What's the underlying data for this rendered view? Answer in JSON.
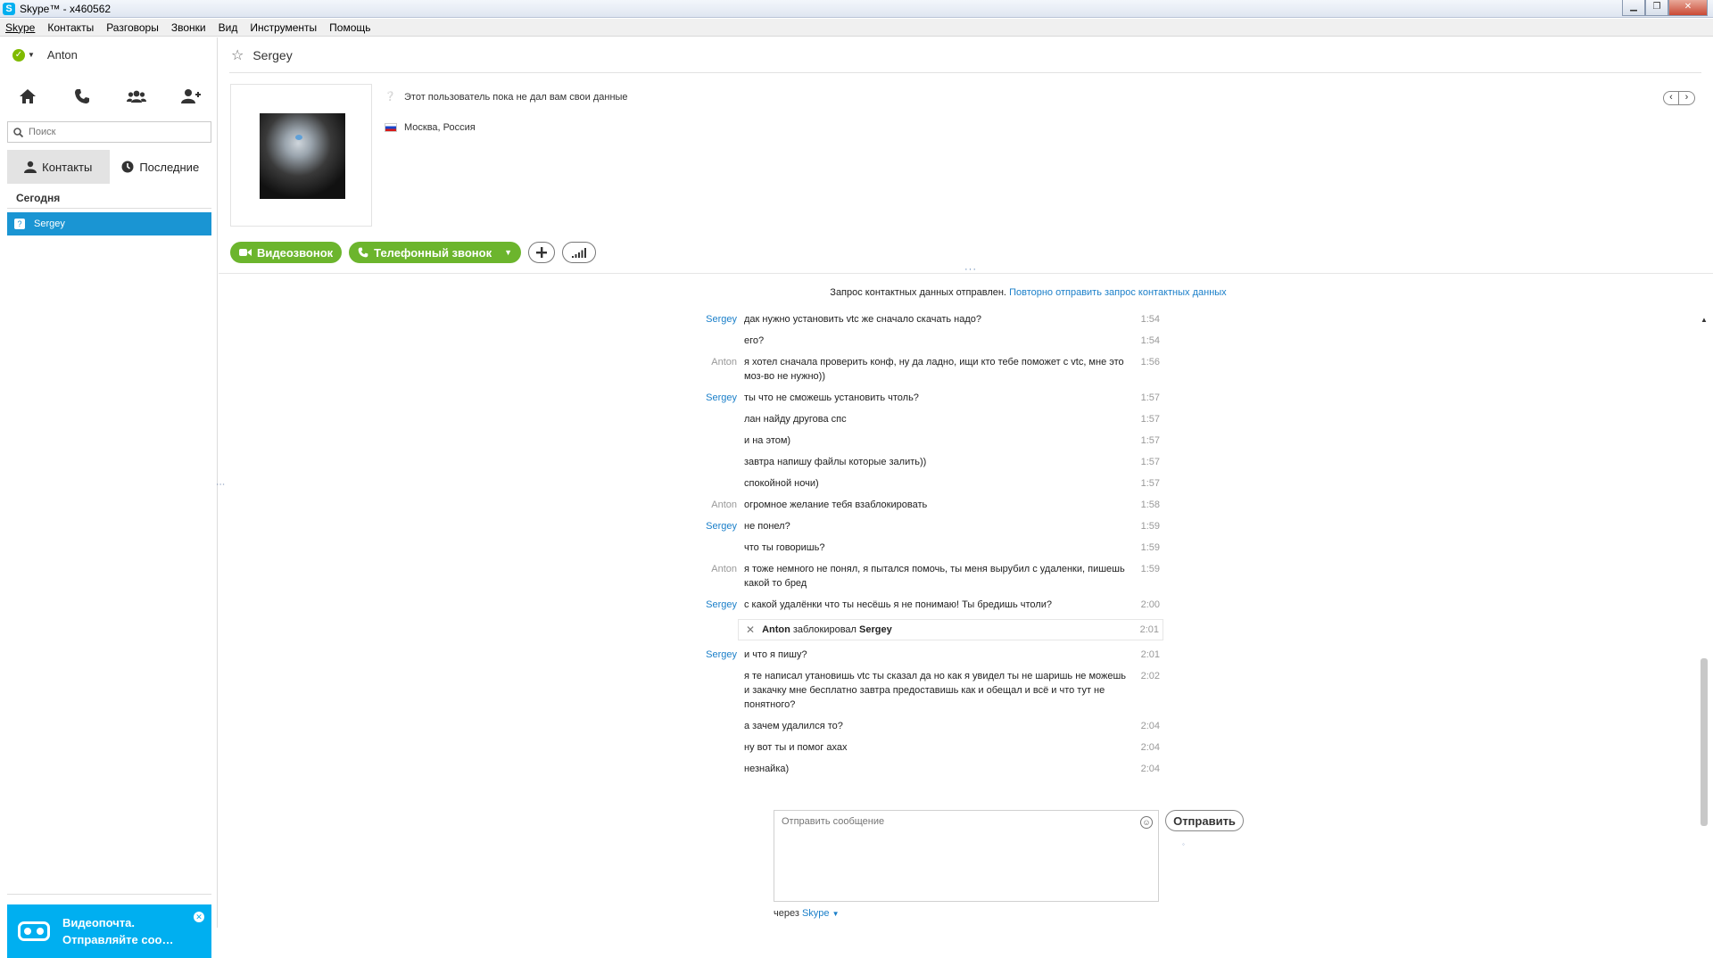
{
  "window": {
    "title": "Skype™ - x460562"
  },
  "menu": [
    "Skype",
    "Контакты",
    "Разговоры",
    "Звонки",
    "Вид",
    "Инструменты",
    "Помощь"
  ],
  "sidebar": {
    "profile_name": "Anton",
    "search_placeholder": "Поиск",
    "tabs": [
      {
        "label": "Контакты",
        "icon": "person-icon"
      },
      {
        "label": "Последние",
        "icon": "clock-icon"
      }
    ],
    "section": "Сегодня",
    "contacts": [
      {
        "name": "Sergey"
      }
    ],
    "videomail": {
      "line1": "Видеопочта.",
      "line2": "Отправляйте соо…"
    }
  },
  "chat": {
    "contact_name": "Sergey",
    "profile_note": "Этот пользователь пока не дал вам свои данные",
    "location": "Москва, Россия",
    "actions": {
      "video_call": "Видеозвонок",
      "phone_call": "Телефонный звонок"
    },
    "notice": {
      "text": "Запрос контактных данных отправлен.",
      "link": "Повторно отправить запрос контактных данных"
    },
    "messages": [
      {
        "author": "Sergey",
        "text": "дак нужно установить vtc же сначало скачать надо?",
        "time": "1:54"
      },
      {
        "author": "",
        "text": "его?",
        "time": "1:54"
      },
      {
        "author": "Anton",
        "text": "я хотел сначала проверить конф, ну да ладно, ищи кто тебе поможет с vtc, мне это моз-во не нужно))",
        "time": "1:56"
      },
      {
        "author": "Sergey",
        "text": "ты что не сможешь установить чтоль?",
        "time": "1:57"
      },
      {
        "author": "",
        "text": "лан найду другова спс",
        "time": "1:57"
      },
      {
        "author": "",
        "text": "и на этом)",
        "time": "1:57"
      },
      {
        "author": "",
        "text": "завтра напишу файлы которые залить))",
        "time": "1:57"
      },
      {
        "author": "",
        "text": "спокойной ночи)",
        "time": "1:57"
      },
      {
        "author": "Anton",
        "text": "огромное желание тебя взаблокировать",
        "time": "1:58"
      },
      {
        "author": "Sergey",
        "text": "не понел?",
        "time": "1:59"
      },
      {
        "author": "",
        "text": "что ты говоришь?",
        "time": "1:59"
      },
      {
        "author": "Anton",
        "text": "я тоже немного не понял, я пытался помочь, ты меня вырубил с удаленки, пишешь какой то бред",
        "time": "1:59"
      },
      {
        "author": "Sergey",
        "text": "с какой удалёнки что ты несёшь я не понимаю! Ты бредишь чтоли?",
        "time": "2:00"
      }
    ],
    "event": {
      "actor": "Anton",
      "verb": "заблокировал",
      "target": "Sergey",
      "time": "2:01"
    },
    "messages_after": [
      {
        "author": "Sergey",
        "text": "и что я пишу?",
        "time": "2:01"
      },
      {
        "author": "",
        "text": "я те написал утановишь vtc ты сказал да но как я увидел ты не шаришь не можешь и закачку мне бесплатно завтра предоставишь как и обещал и всё и что тут не понятного?",
        "time": "2:02"
      },
      {
        "author": "",
        "text": "а зачем удалился то?",
        "time": "2:04"
      },
      {
        "author": "",
        "text": "ну вот ты и помог ахах",
        "time": "2:04"
      },
      {
        "author": "",
        "text": "незнайка)",
        "time": "2:04"
      }
    ],
    "composer_placeholder": "Отправить сообщение",
    "send_label": "Отправить",
    "via_prefix": "через",
    "via_service": "Skype"
  },
  "colors": {
    "accent": "#00aff0",
    "selected_row": "#1a95d3",
    "call_green": "#6cb52d",
    "link": "#1a7fc9"
  }
}
